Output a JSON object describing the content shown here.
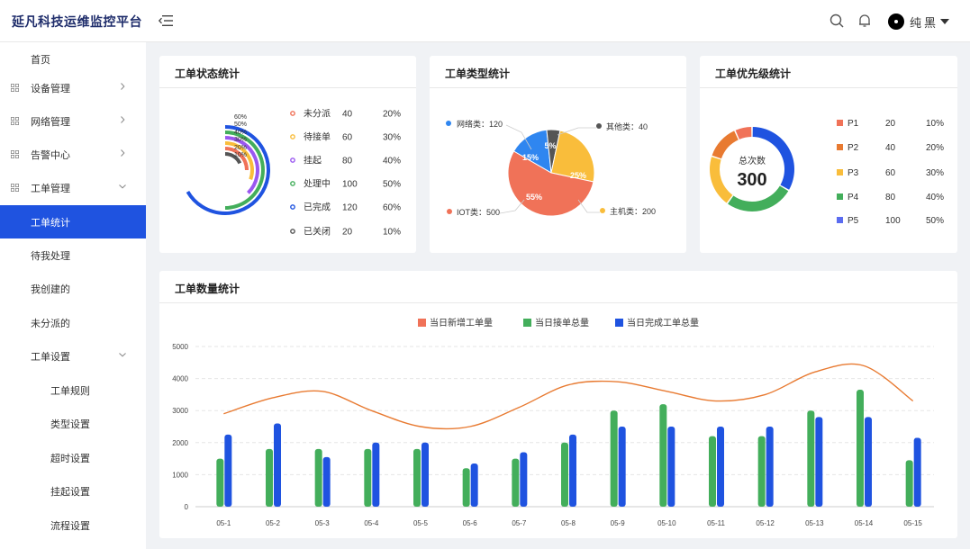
{
  "header": {
    "app_title": "延凡科技运维监控平台",
    "user_name": "纯黑"
  },
  "sidebar": {
    "items": [
      {
        "label": "首页",
        "icon": "none",
        "level": 1,
        "expandable": false,
        "expanded": false,
        "active": false
      },
      {
        "label": "设备管理",
        "icon": "grid-icon",
        "level": 1,
        "expandable": true,
        "expanded": false,
        "active": false
      },
      {
        "label": "网络管理",
        "icon": "grid-icon",
        "level": 1,
        "expandable": true,
        "expanded": false,
        "active": false
      },
      {
        "label": "告警中心",
        "icon": "grid-icon",
        "level": 1,
        "expandable": true,
        "expanded": false,
        "active": false
      },
      {
        "label": "工单管理",
        "icon": "grid-icon",
        "level": 1,
        "expandable": true,
        "expanded": true,
        "active": false
      },
      {
        "label": "工单统计",
        "icon": "none",
        "level": 2,
        "expandable": false,
        "expanded": false,
        "active": true
      },
      {
        "label": "待我处理",
        "icon": "none",
        "level": 2,
        "expandable": false,
        "expanded": false,
        "active": false
      },
      {
        "label": "我创建的",
        "icon": "none",
        "level": 2,
        "expandable": false,
        "expanded": false,
        "active": false
      },
      {
        "label": "未分派的",
        "icon": "none",
        "level": 2,
        "expandable": false,
        "expanded": false,
        "active": false
      },
      {
        "label": "工单设置",
        "icon": "none",
        "level": 2,
        "expandable": true,
        "expanded": true,
        "active": false
      },
      {
        "label": "工单规则",
        "icon": "none",
        "level": 3,
        "expandable": false,
        "expanded": false,
        "active": false
      },
      {
        "label": "类型设置",
        "icon": "none",
        "level": 3,
        "expandable": false,
        "expanded": false,
        "active": false
      },
      {
        "label": "超时设置",
        "icon": "none",
        "level": 3,
        "expandable": false,
        "expanded": false,
        "active": false
      },
      {
        "label": "挂起设置",
        "icon": "none",
        "level": 3,
        "expandable": false,
        "expanded": false,
        "active": false
      },
      {
        "label": "流程设置",
        "icon": "none",
        "level": 3,
        "expandable": false,
        "expanded": false,
        "active": false
      }
    ]
  },
  "colors": {
    "accent": "#1f53e0",
    "red": "#f07258",
    "orange": "#e87a31",
    "yellow": "#f9bd3b",
    "green": "#43ae5b",
    "blue": "#1f53e0",
    "light_blue": "#2f86f0",
    "dark": "#555555",
    "purple": "#9a57f0"
  },
  "cards": {
    "status": {
      "title": "工单状态统计"
    },
    "type": {
      "title": "工单类型统计"
    },
    "priority": {
      "title": "工单优先级统计"
    },
    "count": {
      "title": "工单数量统计"
    }
  },
  "chart_data": [
    {
      "type": "radial-bar",
      "title": "工单状态统计",
      "ring_labels": [
        "60%",
        "50%",
        "40%",
        "30%",
        "20%",
        "10%"
      ],
      "ring_colors": [
        "#1f53e0",
        "#43ae5b",
        "#9a57f0",
        "#f9bd3b",
        "#f07258",
        "#555555"
      ],
      "categories": [
        "未分派",
        "待接单",
        "挂起",
        "处理中",
        "已完成",
        "已关闭"
      ],
      "values": [
        40,
        60,
        80,
        100,
        120,
        20
      ],
      "percents": [
        "20%",
        "30%",
        "40%",
        "50%",
        "60%",
        "10%"
      ],
      "legend_colors": [
        "#f07258",
        "#f9bd3b",
        "#9a57f0",
        "#43ae5b",
        "#1f53e0",
        "#555555"
      ]
    },
    {
      "type": "pie",
      "title": "工单类型统计",
      "slices": [
        {
          "label": "网络类：120",
          "value": 15,
          "pct_label": "15%",
          "color": "#2f86f0"
        },
        {
          "label": "其他类：40",
          "value": 5,
          "pct_label": "5%",
          "color": "#555555"
        },
        {
          "label": "主机类：200",
          "value": 25,
          "pct_label": "25%",
          "color": "#f9bd3b"
        },
        {
          "label": "IOT类：500",
          "value": 55,
          "pct_label": "55%",
          "color": "#f07258"
        }
      ]
    },
    {
      "type": "pie",
      "title": "工单优先级统计",
      "center_label": "总次数",
      "center_value": "300",
      "categories": [
        "P1",
        "P2",
        "P3",
        "P4",
        "P5"
      ],
      "values": [
        20,
        40,
        60,
        80,
        100
      ],
      "percents": [
        "10%",
        "20%",
        "30%",
        "40%",
        "50%"
      ],
      "colors": [
        "#f07258",
        "#e87a31",
        "#f9bd3b",
        "#43ae5b",
        "#5b6cf0"
      ],
      "ring_colors": [
        "#f07258",
        "#e87a31",
        "#f9bd3b",
        "#43ae5b",
        "#1f53e0"
      ]
    },
    {
      "type": "bar",
      "title": "工单数量统计",
      "categories": [
        "05-1",
        "05-2",
        "05-3",
        "05-4",
        "05-5",
        "05-6",
        "05-7",
        "05-8",
        "05-9",
        "05-10",
        "05-11",
        "05-12",
        "05-13",
        "05-14",
        "05-15"
      ],
      "series": [
        {
          "name": "当日新增工单量",
          "kind": "line",
          "color": "#e87a31",
          "legend_color": "#f07258",
          "values": [
            2900,
            3400,
            3600,
            3000,
            2500,
            2500,
            3100,
            3800,
            3900,
            3600,
            3300,
            3500,
            4200,
            4400,
            3300
          ]
        },
        {
          "name": "当日接单总量",
          "kind": "bar",
          "color": "#43ae5b",
          "values": [
            1500,
            1800,
            1800,
            1800,
            1800,
            1200,
            1500,
            2000,
            3000,
            3200,
            2200,
            2200,
            3000,
            3650,
            1450
          ]
        },
        {
          "name": "当日完成工单总量",
          "kind": "bar",
          "color": "#1f53e0",
          "values": [
            2250,
            2600,
            1550,
            2000,
            2000,
            1350,
            1700,
            2250,
            2500,
            2500,
            2500,
            2500,
            2800,
            2800,
            2150
          ]
        }
      ],
      "yticks": [
        "0",
        "1000",
        "2000",
        "3000",
        "4000",
        "5000"
      ],
      "ylim": [
        0,
        5000
      ],
      "legend_position": "top-center",
      "grid": true
    }
  ]
}
